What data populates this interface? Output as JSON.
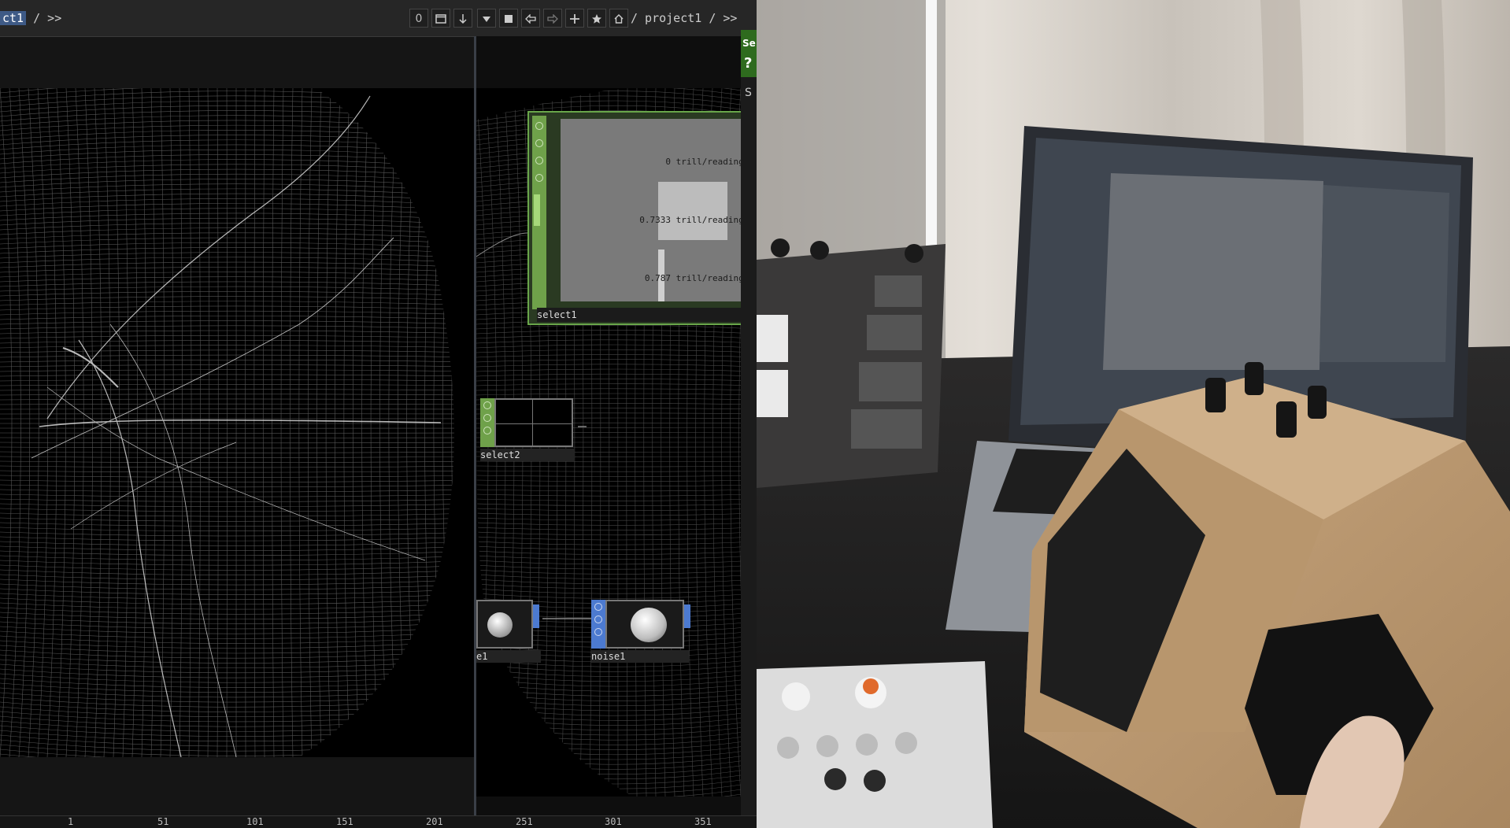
{
  "toolbar": {
    "path_left_highlight": "ct1",
    "path_left_rest": " / >>",
    "counter": "0",
    "path_right": "/ project1 / >>"
  },
  "icons": {
    "window": "window-icon",
    "down": "arrow-down-icon",
    "dropdown": "triangle-down-icon",
    "stop": "square-icon",
    "back": "arrow-left-icon",
    "forward": "arrow-right-icon",
    "add": "plus-icon",
    "favorite": "star-icon",
    "home": "home-icon"
  },
  "side_tab": {
    "title": "Se",
    "help": "?",
    "sub": "S"
  },
  "nodes": {
    "select1": {
      "name": "select1",
      "rows": [
        {
          "value": "0",
          "path": "trill/readings/"
        },
        {
          "value": "0.7333",
          "path": "trill/readings/"
        },
        {
          "value": "0.787",
          "path": "trill/readings/"
        }
      ]
    },
    "select2": {
      "name": "select2"
    },
    "sphere": {
      "name": "e1"
    },
    "noise1": {
      "name": "noise1"
    }
  },
  "timeline": {
    "ticks": [
      "1",
      "51",
      "101",
      "151",
      "201",
      "251",
      "301",
      "351"
    ]
  },
  "colors": {
    "node_green": "#6fa14a",
    "node_blue": "#4c7ad0",
    "path_highlight": "#3e5a86"
  }
}
